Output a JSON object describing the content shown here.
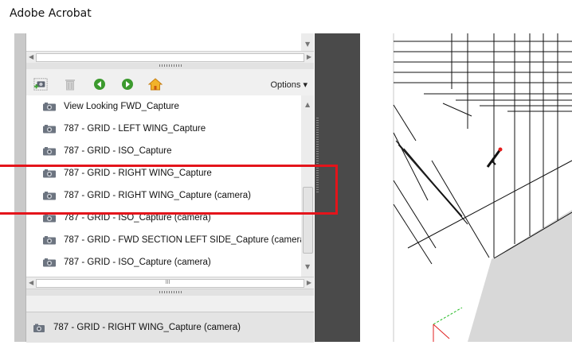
{
  "app": {
    "title": "Adobe Acrobat"
  },
  "toolbar": {
    "options_label": "Options ▾",
    "icons": [
      "camera-add-icon",
      "trash-icon",
      "arrow-left-icon",
      "arrow-right-icon",
      "home-icon"
    ]
  },
  "views": [
    {
      "label": "View Looking FWD_Capture"
    },
    {
      "label": "787 - GRID - LEFT WING_Capture"
    },
    {
      "label": "787 - GRID - ISO_Capture"
    },
    {
      "label": "787 - GRID - RIGHT WING_Capture"
    },
    {
      "label": "787 - GRID - RIGHT WING_Capture (camera)"
    },
    {
      "label": "787 - GRID - ISO_Capture (camera)"
    },
    {
      "label": "787 - GRID - FWD SECTION LEFT SIDE_Capture (camera"
    },
    {
      "label": "787 - GRID - ISO_Capture (camera)"
    }
  ],
  "selected_view": {
    "label": "787 - GRID - RIGHT WING_Capture (camera)"
  },
  "annotation": {
    "color": "#e4141b",
    "highlighted_items": [
      3,
      4
    ]
  },
  "scrollbar_glyph": "III"
}
